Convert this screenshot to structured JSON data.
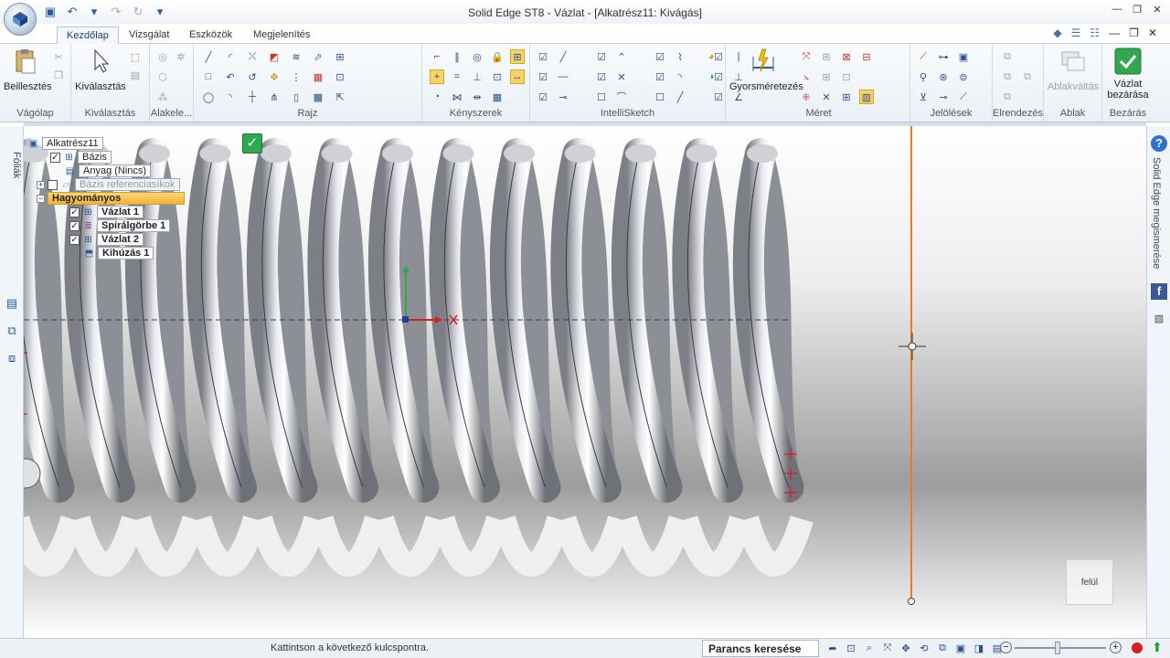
{
  "window": {
    "title": "Solid Edge ST8 - Vázlat - [Alkatrész11: Kivágás]"
  },
  "tabs": [
    {
      "label": "Kezdőlap",
      "active": true
    },
    {
      "label": "Vizsgálat"
    },
    {
      "label": "Eszközök"
    },
    {
      "label": "Megjelenítés"
    }
  ],
  "ribbon": {
    "groups": {
      "vagolap": "Vágólap",
      "kivalasztas": "Kiválasztás",
      "alakele": "Alakele...",
      "rajz": "Rajz",
      "kenyszerek": "Kényszerek",
      "intellisketch": "IntelliSketch",
      "meret": "Méret",
      "jelolesek": "Jelölések",
      "elrendezes": "Elrendezés",
      "ablak": "Ablak",
      "bezaras": "Bezárás"
    },
    "buttons": {
      "paste": "Beillesztés",
      "select": "Kiválasztás",
      "smart_dimension": "Gyorsméretezés",
      "switch_windows": "Ablakváltás",
      "close_sketch_line1": "Vázlat",
      "close_sketch_line2": "bezárása"
    }
  },
  "left_panel": {
    "tab_label": "Fóliák"
  },
  "right_panel": {
    "help_label": "Solid Edge megismerése"
  },
  "tree": {
    "root": "Alkatrész11",
    "items": {
      "base": "Bázis",
      "material": "Anyag (Nincs)",
      "base_refs": "Bázis referenciasíkok",
      "traditional": "Hagyományos",
      "sketch1": "Vázlat 1",
      "helix1": "Spirálgörbe 1",
      "sketch2": "Vázlat 2",
      "extrude1": "Kihúzás 1"
    }
  },
  "viewport": {
    "view_label": "felül"
  },
  "status": {
    "prompt": "Kattintson a következő kulcspontra.",
    "command_search": "Parancs keresése"
  },
  "colors": {
    "selected_tree_item": "#f0b43c",
    "sketch_line": "#e87d1e",
    "accept_green": "#2fa84f"
  }
}
